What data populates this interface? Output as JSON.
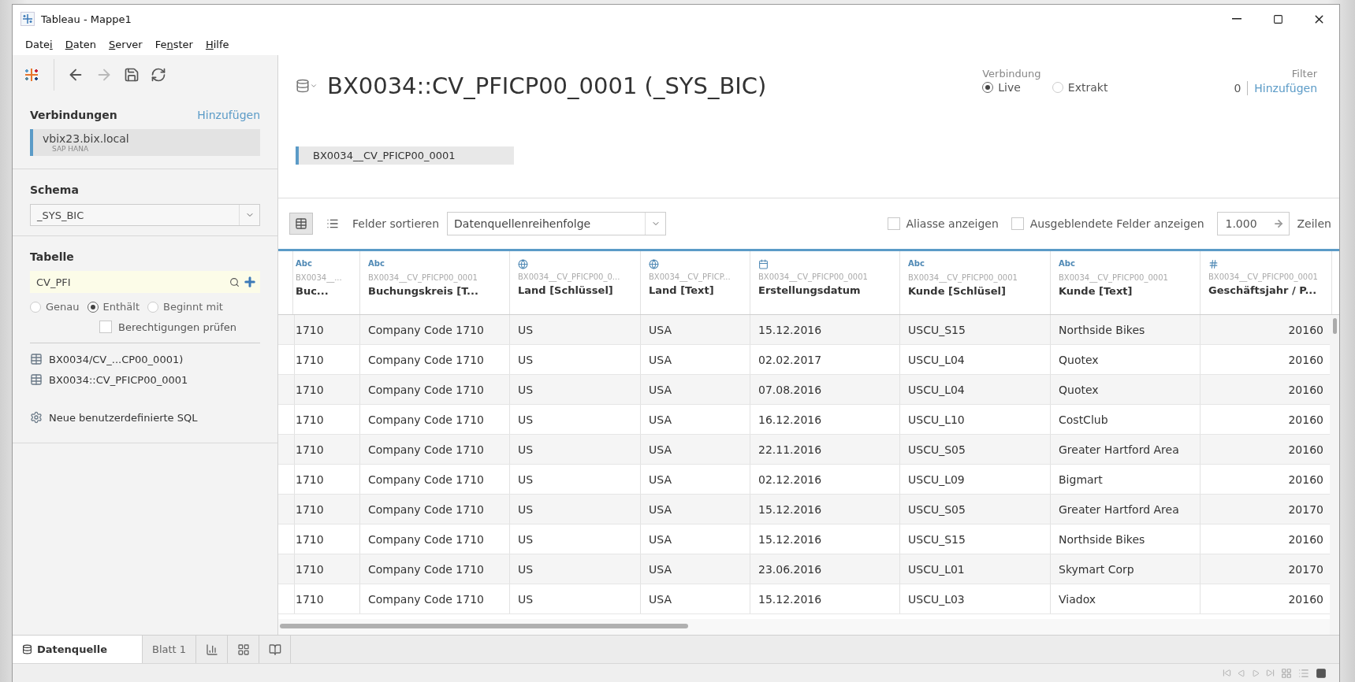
{
  "window": {
    "title": "Tableau - Mappe1"
  },
  "menu": [
    {
      "pre": "Date",
      "key": "i"
    },
    {
      "key": "D",
      "post": "aten"
    },
    {
      "key": "S",
      "post": "erver"
    },
    {
      "pre": "Fe",
      "key": "n",
      "post": "ster"
    },
    {
      "key": "H",
      "post": "ilfe"
    }
  ],
  "toolbar": [
    {
      "kind": "back",
      "disabled": false
    },
    {
      "kind": "forward",
      "disabled": true
    },
    {
      "kind": "save",
      "disabled": false
    },
    {
      "kind": "refresh",
      "disabled": false
    }
  ],
  "sidebar": {
    "connections": {
      "title": "Verbindungen",
      "add_link": "Hinzufügen",
      "items": [
        {
          "name": "vbix23.bix.local",
          "type": "SAP HANA",
          "selected": true
        }
      ]
    },
    "schema": {
      "title": "Schema",
      "value": "_SYS_BIC"
    },
    "table": {
      "title": "Tabelle",
      "search_value": "CV_PFI",
      "match_options": [
        {
          "label": "Genau",
          "selected": false
        },
        {
          "label": "Enthält",
          "selected": true
        },
        {
          "label": "Beginnt mit",
          "selected": false
        }
      ],
      "check_permissions": {
        "label": "Berechtigungen prüfen",
        "checked": false
      },
      "items": [
        {
          "kind": "table",
          "label": "BX0034/CV_...CP00_0001)"
        },
        {
          "kind": "table",
          "label": "BX0034::CV_PFICP00_0001"
        },
        {
          "kind": "sql",
          "label": "Neue benutzerdefinierte SQL"
        }
      ]
    }
  },
  "header": {
    "title": "BX0034::CV_PFICP00_0001 (_SYS_BIC)",
    "connection": {
      "label": "Verbindung",
      "options": [
        {
          "label": "Live",
          "selected": true
        },
        {
          "label": "Extrakt",
          "selected": false
        }
      ]
    },
    "filter": {
      "label": "Filter",
      "count": "0",
      "add_link": "Hinzufügen"
    },
    "canvas_table": "BX0034__CV_PFICP00_0001"
  },
  "grid_toolbar": {
    "views": [
      {
        "kind": "grid",
        "selected": true
      },
      {
        "kind": "list",
        "selected": false
      }
    ],
    "sort_label": "Felder sortieren",
    "sort_value": "Datenquellenreihenfolge",
    "options": [
      {
        "label": "Aliasse anzeigen",
        "checked": false
      },
      {
        "label": "Ausgeblendete Felder anzeigen",
        "checked": false
      }
    ],
    "rows_value": "1.000",
    "rows_label": "Zeilen"
  },
  "grid": {
    "columns": [
      {
        "kind": "string",
        "type_label": "Abc",
        "source": "BX0034__...",
        "name": "Buc..."
      },
      {
        "kind": "string",
        "type_label": "Abc",
        "source": "BX0034__CV_PFICP00_0001",
        "name": "Buchungskreis [T..."
      },
      {
        "kind": "geo",
        "source": "BX0034__CV_PFICP00_0...",
        "name": "Land [Schlüssel]"
      },
      {
        "kind": "geo",
        "source": "BX0034__CV_PFICP...",
        "name": "Land [Text]"
      },
      {
        "kind": "date",
        "source": "BX0034__CV_PFICP00_0001",
        "name": "Erstellungsdatum"
      },
      {
        "kind": "string",
        "type_label": "Abc",
        "source": "BX0034__CV_PFICP00_0001",
        "name": "Kunde [Schlüsel]"
      },
      {
        "kind": "string",
        "type_label": "Abc",
        "source": "BX0034__CV_PFICP00_0001",
        "name": "Kunde [Text]"
      },
      {
        "kind": "number",
        "source": "BX0034__CV_PFICP00_0001",
        "name": "Geschäftsjahr / P..."
      }
    ],
    "rows": [
      [
        "1710",
        "Company Code 1710",
        "US",
        "USA",
        "15.12.2016",
        "USCU_S15",
        "Northside Bikes",
        "20160"
      ],
      [
        "1710",
        "Company Code 1710",
        "US",
        "USA",
        "02.02.2017",
        "USCU_L04",
        "Quotex",
        "20160"
      ],
      [
        "1710",
        "Company Code 1710",
        "US",
        "USA",
        "07.08.2016",
        "USCU_L04",
        "Quotex",
        "20160"
      ],
      [
        "1710",
        "Company Code 1710",
        "US",
        "USA",
        "16.12.2016",
        "USCU_L10",
        "CostClub",
        "20160"
      ],
      [
        "1710",
        "Company Code 1710",
        "US",
        "USA",
        "22.11.2016",
        "USCU_S05",
        "Greater Hartford Area",
        "20160"
      ],
      [
        "1710",
        "Company Code 1710",
        "US",
        "USA",
        "02.12.2016",
        "USCU_L09",
        "Bigmart",
        "20160"
      ],
      [
        "1710",
        "Company Code 1710",
        "US",
        "USA",
        "15.12.2016",
        "USCU_S05",
        "Greater Hartford Area",
        "20170"
      ],
      [
        "1710",
        "Company Code 1710",
        "US",
        "USA",
        "15.12.2016",
        "USCU_S15",
        "Northside Bikes",
        "20160"
      ],
      [
        "1710",
        "Company Code 1710",
        "US",
        "USA",
        "23.06.2016",
        "USCU_L01",
        "Skymart Corp",
        "20170"
      ],
      [
        "1710",
        "Company Code 1710",
        "US",
        "USA",
        "15.12.2016",
        "USCU_L03",
        "Viadox",
        "20160"
      ]
    ]
  },
  "sheet_tabs": [
    {
      "kind": "datasource",
      "label": "Datenquelle",
      "selected": true
    },
    {
      "kind": "sheet",
      "label": "Blatt 1",
      "selected": false
    },
    {
      "kind": "new-sheet"
    },
    {
      "kind": "new-dashboard"
    },
    {
      "kind": "new-story"
    }
  ]
}
